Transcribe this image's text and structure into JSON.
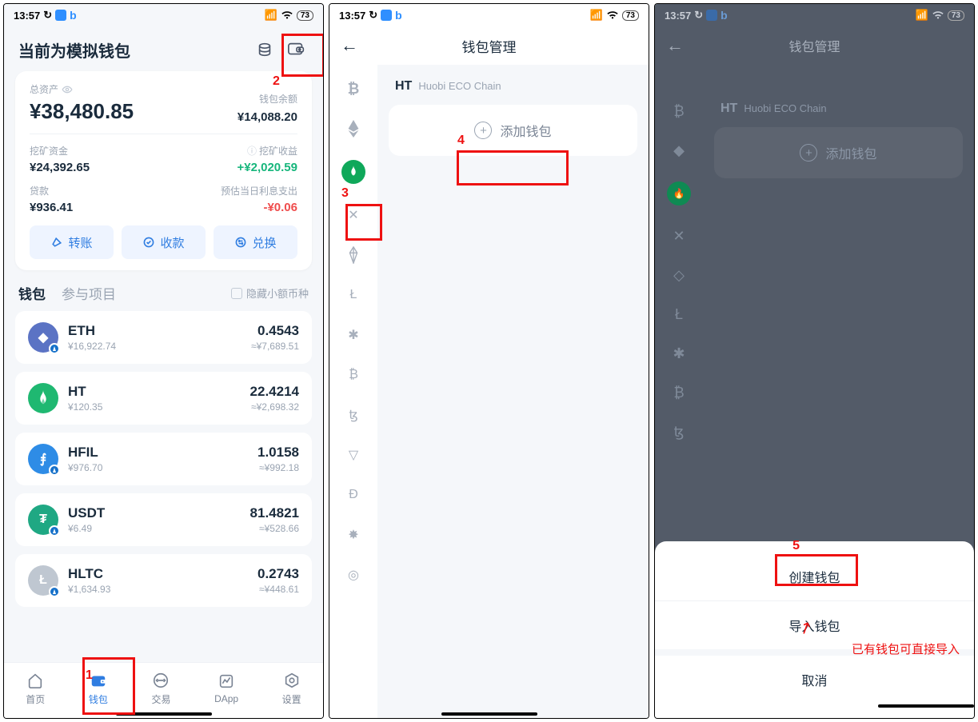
{
  "status": {
    "time": "13:57",
    "battery": "73"
  },
  "screen1": {
    "header_title": "当前为模拟钱包",
    "total_label": "总资产",
    "total_value": "¥38,480.85",
    "balance_label": "钱包余额",
    "balance_value": "¥14,088.20",
    "mining_fund_label": "挖矿资金",
    "mining_fund_value": "¥24,392.65",
    "mining_profit_label": "挖矿收益",
    "mining_profit_value": "+¥2,020.59",
    "loan_label": "贷款",
    "loan_value": "¥936.41",
    "interest_label": "预估当日利息支出",
    "interest_value": "-¥0.06",
    "actions": {
      "transfer": "转账",
      "receive": "收款",
      "exchange": "兑换"
    },
    "tabs": {
      "wallet": "钱包",
      "projects": "参与项目",
      "hide_small": "隐藏小额币种"
    },
    "coins": [
      {
        "symbol": "ETH",
        "price": "¥16,922.74",
        "amount": "0.4543",
        "approx": "≈¥7,689.51"
      },
      {
        "symbol": "HT",
        "price": "¥120.35",
        "amount": "22.4214",
        "approx": "≈¥2,698.32"
      },
      {
        "symbol": "HFIL",
        "price": "¥976.70",
        "amount": "1.0158",
        "approx": "≈¥992.18"
      },
      {
        "symbol": "USDT",
        "price": "¥6.49",
        "amount": "81.4821",
        "approx": "≈¥528.66"
      },
      {
        "symbol": "HLTC",
        "price": "¥1,634.93",
        "amount": "0.2743",
        "approx": "≈¥448.61"
      }
    ],
    "nav": {
      "home": "首页",
      "wallet": "钱包",
      "trade": "交易",
      "dapp": "DApp",
      "settings": "设置"
    }
  },
  "screen2": {
    "title": "钱包管理",
    "chain_symbol": "HT",
    "chain_name": "Huobi ECO Chain",
    "add_wallet": "添加钱包"
  },
  "screen3": {
    "title": "钱包管理",
    "chain_symbol": "HT",
    "chain_name": "Huobi ECO Chain",
    "add_wallet": "添加钱包",
    "sheet": {
      "create": "创建钱包",
      "import": "导入钱包",
      "cancel": "取消"
    },
    "note": "已有钱包可直接导入"
  },
  "annotations": {
    "n1": "1",
    "n2": "2",
    "n3": "3",
    "n4": "4",
    "n5": "5"
  }
}
